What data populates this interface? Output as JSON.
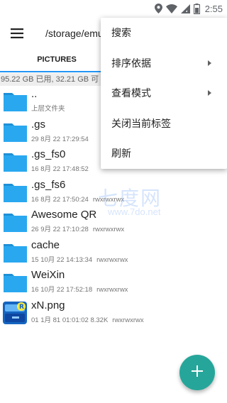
{
  "status_bar": {
    "time": "2:55",
    "icons": [
      "location-icon",
      "wifi-icon",
      "signal-icon",
      "battery-icon"
    ]
  },
  "app_bar": {
    "menu_icon": "hamburger-menu-icon",
    "path": "/storage/emul"
  },
  "tabs": [
    {
      "label": "PICTURES",
      "active": true
    }
  ],
  "storage_info": "95.22 GB 已用, 32.21 GB 可",
  "files": [
    {
      "name": "..",
      "meta": "上层文件夹",
      "perm": "",
      "type": "folder"
    },
    {
      "name": ".gs",
      "meta": "29 8月 22 17:29:54",
      "perm": "",
      "type": "folder"
    },
    {
      "name": ".gs_fs0",
      "meta": "16 8月 22 17:48:52",
      "perm": "",
      "type": "folder"
    },
    {
      "name": ".gs_fs6",
      "meta": "16 8月 22 17:50:24",
      "perm": "rwxrwxrwx",
      "type": "folder"
    },
    {
      "name": "Awesome QR",
      "meta": "26 9月 22 17:10:28",
      "perm": "rwxrwxrwx",
      "type": "folder"
    },
    {
      "name": "cache",
      "meta": "15 10月 22 14:13:34",
      "perm": "rwxrwxrwx",
      "type": "folder"
    },
    {
      "name": "WeiXin",
      "meta": "16 10月 22 17:52:18",
      "perm": "rwxrwxrwx",
      "type": "folder"
    },
    {
      "name": "xN.png",
      "meta": "01 1月 81 01:01:02  8.32K",
      "perm": "rwxrwxrwx",
      "type": "image"
    }
  ],
  "menu": {
    "items": [
      {
        "label": "搜索",
        "submenu": false
      },
      {
        "label": "排序依据",
        "submenu": true
      },
      {
        "label": "查看模式",
        "submenu": true
      },
      {
        "label": "关闭当前标签",
        "submenu": false
      },
      {
        "label": "刷新",
        "submenu": false
      }
    ]
  },
  "watermark": {
    "main": "七度网",
    "sub": "www.7do.net"
  },
  "fab": {
    "icon": "plus-icon"
  },
  "colors": {
    "accent": "#2196f3",
    "folder": "#29a8f0",
    "fab": "#26a69a",
    "storage_bar": "#eeeeee"
  }
}
